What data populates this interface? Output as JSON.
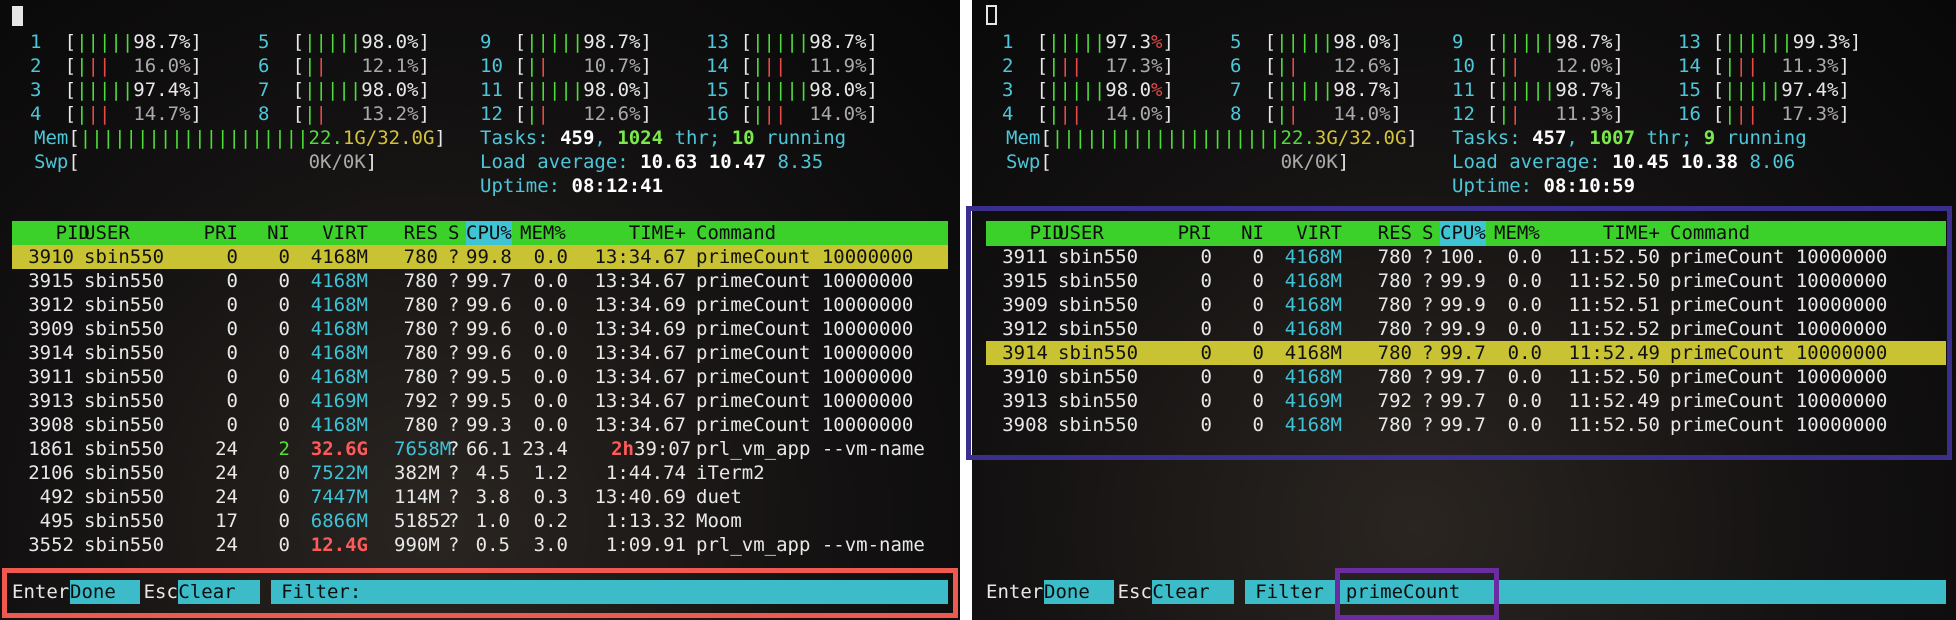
{
  "left": {
    "cpus": [
      {
        "num": "1",
        "bar": "|||||",
        "pct": "98.7%",
        "hi": true,
        "red": ""
      },
      {
        "num": "2",
        "bar": "|",
        "pct": " 16.0%",
        "hi": false,
        "red": "||"
      },
      {
        "num": "3",
        "bar": "|||||",
        "pct": "97.4%",
        "hi": true,
        "red": ""
      },
      {
        "num": "4",
        "bar": "|",
        "pct": " 14.7%",
        "hi": false,
        "red": "||"
      },
      {
        "num": "5",
        "bar": "|||||",
        "pct": "98.0%",
        "hi": true,
        "red": ""
      },
      {
        "num": "6",
        "bar": "|",
        "pct": " 12.1%",
        "hi": false,
        "red": "|"
      },
      {
        "num": "7",
        "bar": "|||||",
        "pct": "98.0%",
        "hi": true,
        "red": ""
      },
      {
        "num": "8",
        "bar": "|",
        "pct": " 13.2%",
        "hi": false,
        "red": "|"
      },
      {
        "num": "9",
        "bar": "|||||",
        "pct": "98.7%",
        "hi": true,
        "red": ""
      },
      {
        "num": "10",
        "bar": "|",
        "pct": " 10.7%",
        "hi": false,
        "red": "|"
      },
      {
        "num": "11",
        "bar": "|||||",
        "pct": "98.0%",
        "hi": true,
        "red": ""
      },
      {
        "num": "12",
        "bar": "|",
        "pct": " 12.6%",
        "hi": false,
        "red": "|"
      },
      {
        "num": "13",
        "bar": "|||||",
        "pct": "98.7%",
        "hi": true,
        "red": ""
      },
      {
        "num": "14",
        "bar": "|",
        "pct": " 11.9%",
        "hi": false,
        "red": "||"
      },
      {
        "num": "15",
        "bar": "|||||",
        "pct": "98.0%",
        "hi": true,
        "red": ""
      },
      {
        "num": "16",
        "bar": "|",
        "pct": " 14.0%",
        "hi": false,
        "red": "||"
      }
    ],
    "mem_label": "Mem",
    "mem_bar": "||||||||||||||||||||22.",
    "mem_val": "1G/32.0G",
    "swp_label": "Swp",
    "swp_val": "0K/0K",
    "tasks_label": "Tasks: ",
    "tasks": "459",
    "thr": "1024",
    "thr_label": " thr; ",
    "running": "10",
    "running_label": " running",
    "load_label": "Load average: ",
    "load1": "10.63",
    "load5": "10.47",
    "load15": "8.35",
    "uptime_label": "Uptime: ",
    "uptime": "08:12:41",
    "processes": [
      {
        "pid": "3910",
        "user": "sbin550",
        "pri": "0",
        "ni": "0",
        "virt": "4168M",
        "res": "780",
        "s": "?",
        "cpu": "99.8",
        "mem": "0.0",
        "time": "13:34.67",
        "cmd": "primeCount 10000000",
        "sel": true
      },
      {
        "pid": "3915",
        "user": "sbin550",
        "pri": "0",
        "ni": "0",
        "virt": "4168M",
        "res": "780",
        "s": "?",
        "cpu": "99.7",
        "mem": "0.0",
        "time": "13:34.67",
        "cmd": "primeCount 10000000"
      },
      {
        "pid": "3912",
        "user": "sbin550",
        "pri": "0",
        "ni": "0",
        "virt": "4168M",
        "res": "780",
        "s": "?",
        "cpu": "99.6",
        "mem": "0.0",
        "time": "13:34.69",
        "cmd": "primeCount 10000000"
      },
      {
        "pid": "3909",
        "user": "sbin550",
        "pri": "0",
        "ni": "0",
        "virt": "4168M",
        "res": "780",
        "s": "?",
        "cpu": "99.6",
        "mem": "0.0",
        "time": "13:34.69",
        "cmd": "primeCount 10000000"
      },
      {
        "pid": "3914",
        "user": "sbin550",
        "pri": "0",
        "ni": "0",
        "virt": "4168M",
        "res": "780",
        "s": "?",
        "cpu": "99.6",
        "mem": "0.0",
        "time": "13:34.67",
        "cmd": "primeCount 10000000"
      },
      {
        "pid": "3911",
        "user": "sbin550",
        "pri": "0",
        "ni": "0",
        "virt": "4168M",
        "res": "780",
        "s": "?",
        "cpu": "99.5",
        "mem": "0.0",
        "time": "13:34.67",
        "cmd": "primeCount 10000000"
      },
      {
        "pid": "3913",
        "user": "sbin550",
        "pri": "0",
        "ni": "0",
        "virt": "4169M",
        "res": "792",
        "s": "?",
        "cpu": "99.5",
        "mem": "0.0",
        "time": "13:34.67",
        "cmd": "primeCount 10000000"
      },
      {
        "pid": "3908",
        "user": "sbin550",
        "pri": "0",
        "ni": "0",
        "virt": "4168M",
        "res": "780",
        "s": "?",
        "cpu": "99.3",
        "mem": "0.0",
        "time": "13:34.67",
        "cmd": "primeCount 10000000"
      },
      {
        "pid": "1861",
        "user": "sbin550",
        "pri": "24",
        "ni": "2",
        "virt": "32.6G",
        "res": "7658M",
        "s": "?",
        "cpu": "66.1",
        "mem": "23.4",
        "time_hi": "2h",
        "time": "39:07",
        "cmd": "prl_vm_app --vm-name",
        "big": true
      },
      {
        "pid": "2106",
        "user": "sbin550",
        "pri": "24",
        "ni": "0",
        "virt": "7522M",
        "res": "382M",
        "s": "?",
        "cpu": "4.5",
        "mem": "1.2",
        "time": "1:44.74",
        "cmd": "iTerm2"
      },
      {
        "pid": "492",
        "user": "sbin550",
        "pri": "24",
        "ni": "0",
        "virt": "7447M",
        "res": "114M",
        "s": "?",
        "cpu": "3.8",
        "mem": "0.3",
        "time": "13:40.69",
        "cmd": "duet"
      },
      {
        "pid": "495",
        "user": "sbin550",
        "pri": "17",
        "ni": "0",
        "virt": "6866M",
        "res": "51852",
        "s": "?",
        "cpu": "1.0",
        "mem": "0.2",
        "time": "1:13.32",
        "cmd": "Moom"
      },
      {
        "pid": "3552",
        "user": "sbin550",
        "pri": "24",
        "ni": "0",
        "virt": "12.4G",
        "res": "990M",
        "s": "?",
        "cpu": "0.5",
        "mem": "3.0",
        "time": "1:09.91",
        "cmd": "prl_vm_app --vm-name",
        "bigvirt": true
      }
    ],
    "footer": {
      "enter": "Enter",
      "done": "Done",
      "esc": "Esc",
      "clear": "Clear",
      "filter": "Filter: ",
      "value": ""
    }
  },
  "right": {
    "cpus": [
      {
        "num": "1",
        "bar": "|||||",
        "pct": "97.3",
        "pct2": "%",
        "hi": true,
        "red": ""
      },
      {
        "num": "2",
        "bar": "|",
        "pct": " 17.3%",
        "hi": false,
        "red": "||"
      },
      {
        "num": "3",
        "bar": "|||||",
        "pct": "98.0",
        "pct2": "%",
        "hi": true,
        "red": ""
      },
      {
        "num": "4",
        "bar": "|",
        "pct": " 14.0%",
        "hi": false,
        "red": "||"
      },
      {
        "num": "5",
        "bar": "|||||",
        "pct": "98.0%",
        "hi": true,
        "red": ""
      },
      {
        "num": "6",
        "bar": "|",
        "pct": " 12.6%",
        "hi": false,
        "red": "|"
      },
      {
        "num": "7",
        "bar": "|||||",
        "pct": "98.7%",
        "hi": true,
        "red": ""
      },
      {
        "num": "8",
        "bar": "|",
        "pct": " 14.0%",
        "hi": false,
        "red": "|"
      },
      {
        "num": "9",
        "bar": "|||||",
        "pct": "98.7%",
        "hi": true,
        "red": ""
      },
      {
        "num": "10",
        "bar": "|",
        "pct": " 12.0%",
        "hi": false,
        "red": "|"
      },
      {
        "num": "11",
        "bar": "|||||",
        "pct": "98.7%",
        "hi": true,
        "red": ""
      },
      {
        "num": "12",
        "bar": "|",
        "pct": " 11.3%",
        "hi": false,
        "red": "|"
      },
      {
        "num": "13",
        "bar": "||||||",
        "pct": "99.3%",
        "hi": true,
        "red": ""
      },
      {
        "num": "14",
        "bar": "|",
        "pct": " 11.3%",
        "hi": false,
        "red": "||"
      },
      {
        "num": "15",
        "bar": "|||||",
        "pct": "97.4%",
        "hi": true,
        "red": ""
      },
      {
        "num": "16",
        "bar": "|",
        "pct": " 17.3%",
        "hi": false,
        "red": "||"
      }
    ],
    "mem_label": "Mem",
    "mem_bar": "||||||||||||||||||||22.",
    "mem_val": "3G/32.0G",
    "swp_label": "Swp",
    "swp_val": "0K/0K",
    "tasks_label": "Tasks: ",
    "tasks": "457",
    "thr": "1007",
    "thr_label": " thr; ",
    "running": "9",
    "running_label": " running",
    "load_label": "Load average: ",
    "load1": "10.45",
    "load5": "10.38",
    "load15": "8.06",
    "uptime_label": "Uptime: ",
    "uptime": "08:10:59",
    "processes": [
      {
        "pid": "3911",
        "user": "sbin550",
        "pri": "0",
        "ni": "0",
        "virt": "4168M",
        "res": "780",
        "s": "?",
        "cpu": "100.",
        "mem": "0.0",
        "time": "11:52.50",
        "cmd": "primeCount 10000000"
      },
      {
        "pid": "3915",
        "user": "sbin550",
        "pri": "0",
        "ni": "0",
        "virt": "4168M",
        "res": "780",
        "s": "?",
        "cpu": "99.9",
        "mem": "0.0",
        "time": "11:52.50",
        "cmd": "primeCount 10000000"
      },
      {
        "pid": "3909",
        "user": "sbin550",
        "pri": "0",
        "ni": "0",
        "virt": "4168M",
        "res": "780",
        "s": "?",
        "cpu": "99.9",
        "mem": "0.0",
        "time": "11:52.51",
        "cmd": "primeCount 10000000"
      },
      {
        "pid": "3912",
        "user": "sbin550",
        "pri": "0",
        "ni": "0",
        "virt": "4168M",
        "res": "780",
        "s": "?",
        "cpu": "99.9",
        "mem": "0.0",
        "time": "11:52.52",
        "cmd": "primeCount 10000000"
      },
      {
        "pid": "3914",
        "user": "sbin550",
        "pri": "0",
        "ni": "0",
        "virt": "4168M",
        "res": "780",
        "s": "?",
        "cpu": "99.7",
        "mem": "0.0",
        "time": "11:52.49",
        "cmd": "primeCount 10000000",
        "sel": true
      },
      {
        "pid": "3910",
        "user": "sbin550",
        "pri": "0",
        "ni": "0",
        "virt": "4168M",
        "res": "780",
        "s": "?",
        "cpu": "99.7",
        "mem": "0.0",
        "time": "11:52.50",
        "cmd": "primeCount 10000000"
      },
      {
        "pid": "3913",
        "user": "sbin550",
        "pri": "0",
        "ni": "0",
        "virt": "4169M",
        "res": "792",
        "s": "?",
        "cpu": "99.7",
        "mem": "0.0",
        "time": "11:52.49",
        "cmd": "primeCount 10000000"
      },
      {
        "pid": "3908",
        "user": "sbin550",
        "pri": "0",
        "ni": "0",
        "virt": "4168M",
        "res": "780",
        "s": "?",
        "cpu": "99.7",
        "mem": "0.0",
        "time": "11:52.50",
        "cmd": "primeCount 10000000"
      }
    ],
    "footer": {
      "enter": "Enter",
      "done": "Done",
      "esc": "Esc",
      "clear": "Clear",
      "filter": "Filter",
      "value": "primeCount"
    }
  },
  "columns": {
    "pid": "PID",
    "user": "USER",
    "pri": "PRI",
    "ni": "NI",
    "virt": "VIRT",
    "res": "RES",
    "s": "S",
    "cpu": "CPU%",
    "mem": "MEM%",
    "time": "TIME+",
    "cmd": "Command"
  },
  "colors": {
    "annotation_red": "#ef5a50",
    "annotation_blue": "#3a2f8c",
    "annotation_purple": "#6a2ca0",
    "header_green": "#3bd12a",
    "selected_yellow": "#c9c232"
  }
}
